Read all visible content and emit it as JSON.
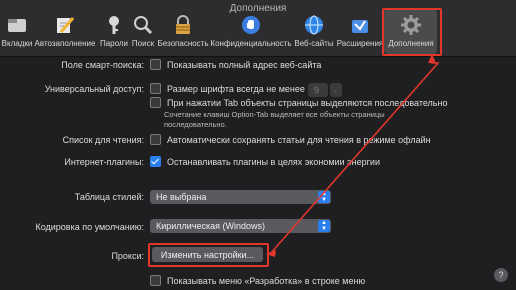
{
  "window": {
    "title": "Дополнения"
  },
  "toolbar": {
    "items": [
      {
        "label": "Вкладки",
        "icon": "tabs-icon"
      },
      {
        "label": "Автозаполнение",
        "icon": "pencil-icon"
      },
      {
        "label": "Пароли",
        "icon": "key-icon"
      },
      {
        "label": "Поиск",
        "icon": "search-icon"
      },
      {
        "label": "Безопасность",
        "icon": "lock-icon"
      },
      {
        "label": "Конфиденциальность",
        "icon": "hand-icon"
      },
      {
        "label": "Веб-сайты",
        "icon": "globe-icon"
      },
      {
        "label": "Расширения",
        "icon": "puzzle-icon"
      },
      {
        "label": "Дополнения",
        "icon": "gear-icon"
      }
    ]
  },
  "smart_search": {
    "label": "Поле смарт-поиска:",
    "option": "Показывать полный адрес веб-сайта",
    "checked": false
  },
  "accessibility": {
    "label": "Универсальный доступ:",
    "font_option": "Размер шрифта всегда не менее",
    "font_value": "9",
    "tab_option": "При нажатии Tab объекты страницы выделяются последовательно",
    "tab_note": "Сочетание клавиш Option-Tab выделяет все объекты страницы последовательно."
  },
  "reading_list": {
    "label": "Список для чтения:",
    "option": "Автоматически сохранять статьи для чтения в режиме офлайн"
  },
  "plugins": {
    "label": "Интернет-плагины:",
    "option": "Останавливать плагины в целях экономии энергии",
    "checked": true
  },
  "stylesheet": {
    "label": "Таблица стилей:",
    "value": "Не выбрана"
  },
  "encoding": {
    "label": "Кодировка по умолчанию:",
    "value": "Кириллическая (Windows)"
  },
  "proxy": {
    "label": "Прокси:",
    "button": "Изменить настройки..."
  },
  "develop_menu": {
    "option": "Показывать меню «Разработка» в строке меню"
  },
  "help": {
    "label": "?"
  },
  "colors": {
    "highlight": "#e0362c",
    "accent": "#2a7ff0"
  }
}
